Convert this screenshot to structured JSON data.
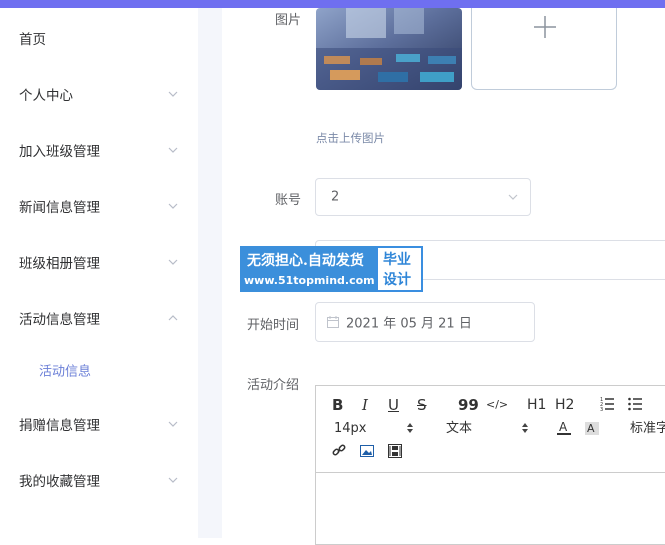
{
  "sidebar": {
    "items": [
      {
        "label": "首页"
      },
      {
        "label": "个人中心"
      },
      {
        "label": "加入班级管理"
      },
      {
        "label": "新闻信息管理"
      },
      {
        "label": "班级相册管理"
      },
      {
        "label": "活动信息管理"
      },
      {
        "label": "捐赠信息管理"
      },
      {
        "label": "我的收藏管理"
      }
    ],
    "sub_item": {
      "label": "活动信息"
    }
  },
  "form": {
    "image": {
      "label": "图片",
      "hint": "点击上传图片"
    },
    "account": {
      "label": "账号",
      "value": "2"
    },
    "start_time": {
      "label": "开始时间",
      "value": "2021 年 05 月 21 日"
    },
    "intro": {
      "label": "活动介绍"
    }
  },
  "watermark": {
    "line1": "无须担心.自动发货",
    "line2": "www.51topmind.com",
    "right1": "毕业",
    "right2": "设计"
  },
  "editor": {
    "toolbar": {
      "bold": "B",
      "italic": "I",
      "underline": "U",
      "strike": "S",
      "quote": "99",
      "code": "</>",
      "h1": "H1",
      "h2": "H2",
      "font_size": "14px",
      "font_family": "文本",
      "line_height": "标准字"
    }
  },
  "colors": {
    "topbar": "#6f6ff0",
    "accent": "#6b7fd7",
    "watermark_blue": "#3a8ee0"
  }
}
